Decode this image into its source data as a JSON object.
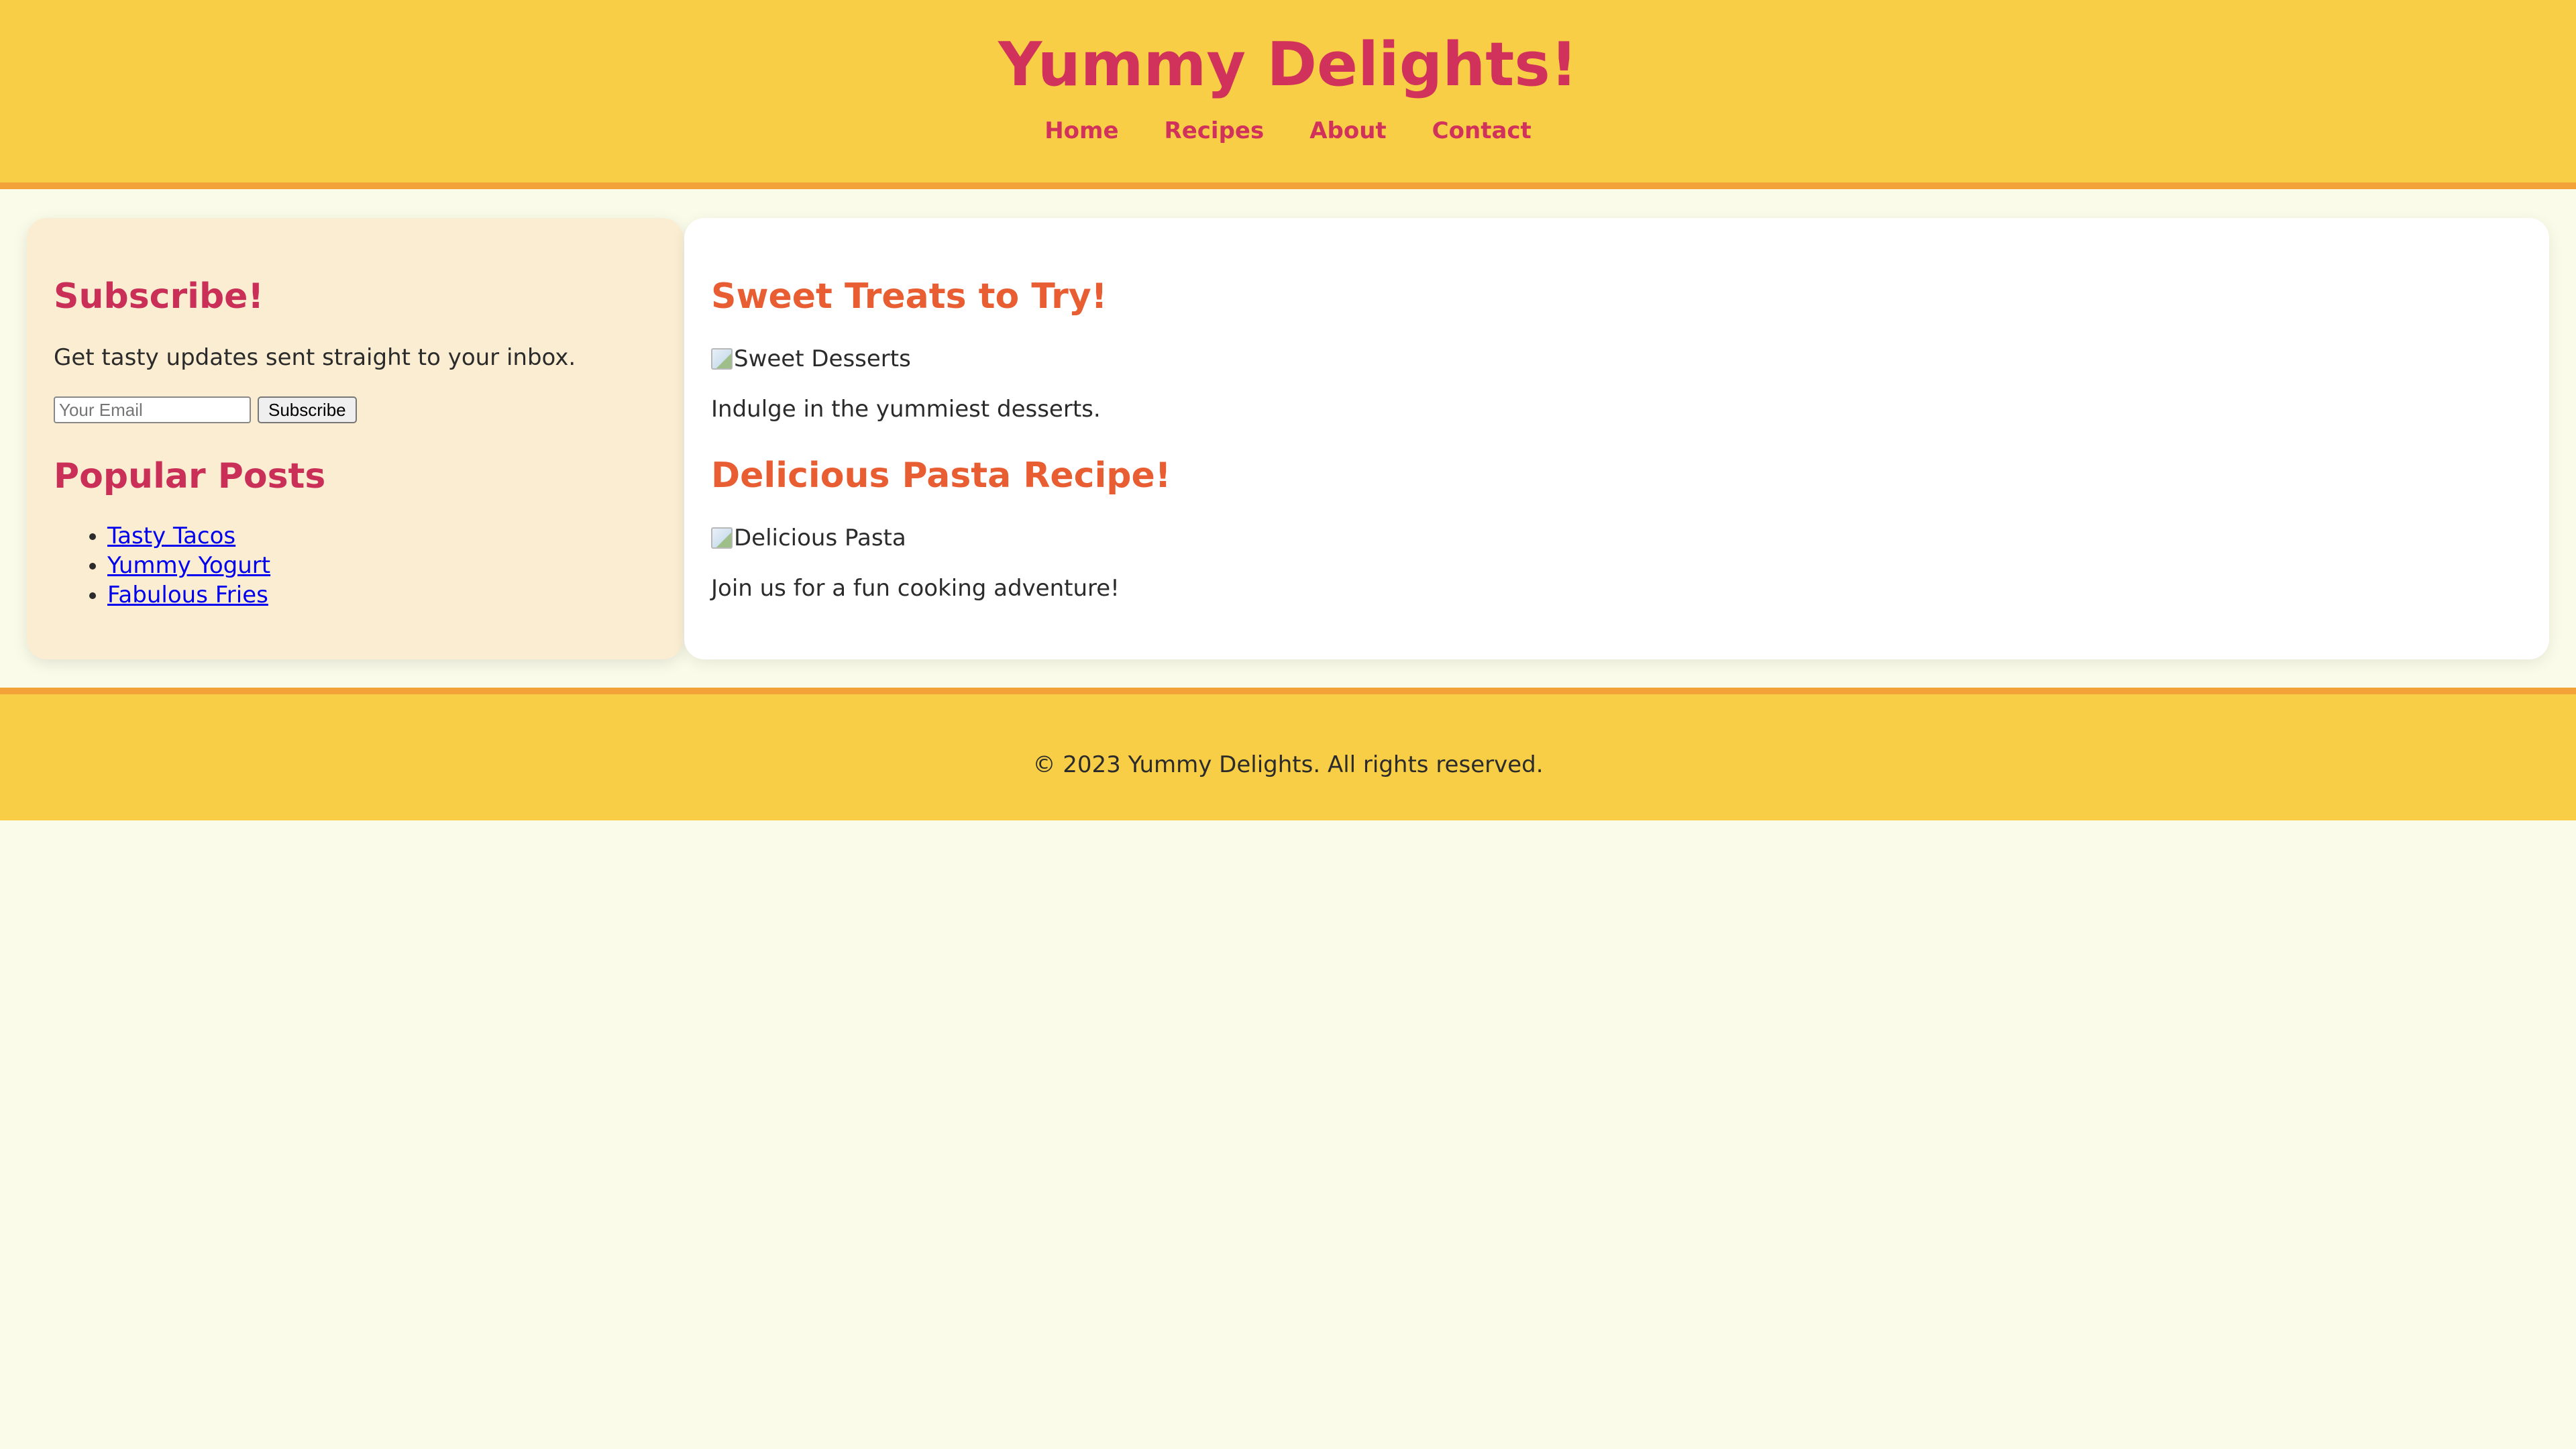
{
  "site": {
    "title": "Yummy Delights!"
  },
  "nav": {
    "items": [
      "Home",
      "Recipes",
      "About",
      "Contact"
    ]
  },
  "sidebar": {
    "subscribe_heading": "Subscribe!",
    "subscribe_text": "Get tasty updates sent straight to your inbox.",
    "email_placeholder": "Your Email",
    "email_value": "",
    "subscribe_button": "Subscribe",
    "popular_heading": "Popular Posts",
    "popular_posts": [
      "Tasty Tacos",
      "Yummy Yogurt",
      "Fabulous Fries"
    ]
  },
  "main": {
    "articles": [
      {
        "title": "Sweet Treats to Try!",
        "image_alt": "Sweet Desserts",
        "description": "Indulge in the yummiest desserts."
      },
      {
        "title": "Delicious Pasta Recipe!",
        "image_alt": "Delicious Pasta",
        "description": "Join us for a fun cooking adventure!"
      }
    ]
  },
  "footer": {
    "text": "© 2023 Yummy Delights. All rights reserved."
  },
  "colors": {
    "header_bg": "#f8ce47",
    "header_border": "#f2a238",
    "brand_pink": "#d0325b",
    "article_orange": "#e85d32",
    "sidebar_bg": "#fbedd2",
    "page_bg": "#fafbe9",
    "link_blue": "#0000ee"
  }
}
